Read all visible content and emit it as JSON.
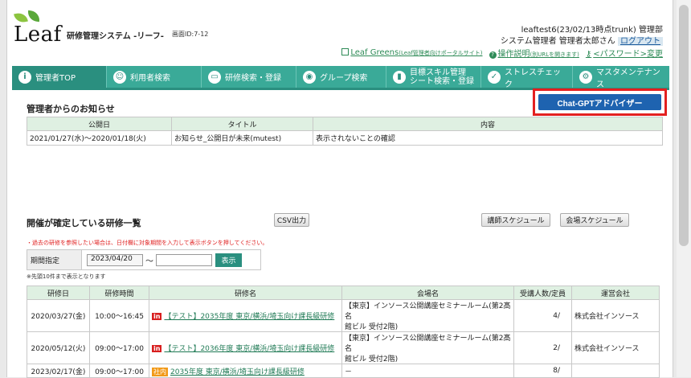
{
  "header": {
    "logo": "Leaf",
    "system_title": "研修管理システム -リーフ-",
    "screen_id": "画面ID:7-12",
    "user_line1": "leaftest6(23/02/13時点trunk) 管理部",
    "user_line2": "システム管理者 管理者太郎さん",
    "logout": "ログアウト",
    "leaf_greens": "Leaf Greens",
    "leaf_greens_note": "(Leaf管理者向けポータルサイト)",
    "manual": "操作説明",
    "manual_note": "(別URLを開きます)",
    "password": "<パスワード>変更"
  },
  "nav": {
    "items": [
      {
        "label": "管理者TOP",
        "icon": "i"
      },
      {
        "label": "利用者検索",
        "icon": "☺"
      },
      {
        "label": "研修検索・登録",
        "icon": "▭"
      },
      {
        "label": "グループ検索",
        "icon": "◉"
      },
      {
        "label1": "目標スキル管理",
        "label2": "シート検索・登録",
        "icon": "▮"
      },
      {
        "label": "ストレスチェック",
        "icon": "✓"
      },
      {
        "label": "マスタメンテナンス",
        "icon": "⚙"
      }
    ]
  },
  "notices": {
    "title": "管理者からのお知らせ",
    "gpt_button": "Chat-GPTアドバイザー",
    "columns": [
      "公開日",
      "タイトル",
      "内容"
    ],
    "rows": [
      {
        "date": "2021/01/27(水)～2020/01/18(火)",
        "title": "お知らせ_公開日が未来(mutest)",
        "content": "表示されないことの確認"
      }
    ]
  },
  "courses": {
    "title": "開催が確定している研修一覧",
    "csv_button": "CSV出力",
    "instructor_button": "講師スケジュール",
    "venue_button": "会場スケジュール",
    "note_red": "・過去の研修を参照したい場合は、日付欄に対象期間を入力して表示ボタンを押してください。",
    "period_label": "期間指定",
    "period_from": "2023/04/20",
    "tilde": "～",
    "show_button": "表示",
    "note_small": "※先頭10件まで表示となります",
    "columns": [
      "研修日",
      "研修時間",
      "研修名",
      "会場名",
      "受講人数/定員",
      "運営会社"
    ],
    "rows": [
      {
        "date": "2020/03/27(金)",
        "time": "10:00～16:45",
        "tag": "in",
        "name": "【テスト】2035年度 東京/横浜/埼玉向け課長級研修",
        "venue1": "【東京】インソース公開講座セミナールーム(第2髙名",
        "venue2": "館ビル 受付2階)",
        "count": "4/",
        "company": "株式会社インソース"
      },
      {
        "date": "2020/05/12(火)",
        "time": "09:00～17:00",
        "tag": "in",
        "name": "【テスト】2036年度 東京/横浜/埼玉向け課長級研修",
        "venue1": "【東京】インソース公開講座セミナールーム(第2髙名",
        "venue2": "館ビル 受付2階)",
        "count": "2/",
        "company": "株式会社インソース"
      },
      {
        "date": "2023/02/17(金)",
        "time": "09:00～17:00",
        "tag": "社内",
        "name": "2035年度 東京/横浜/埼玉向け課長級研修",
        "venue1": "－",
        "venue2": "",
        "count": "8/",
        "company": ""
      }
    ]
  }
}
